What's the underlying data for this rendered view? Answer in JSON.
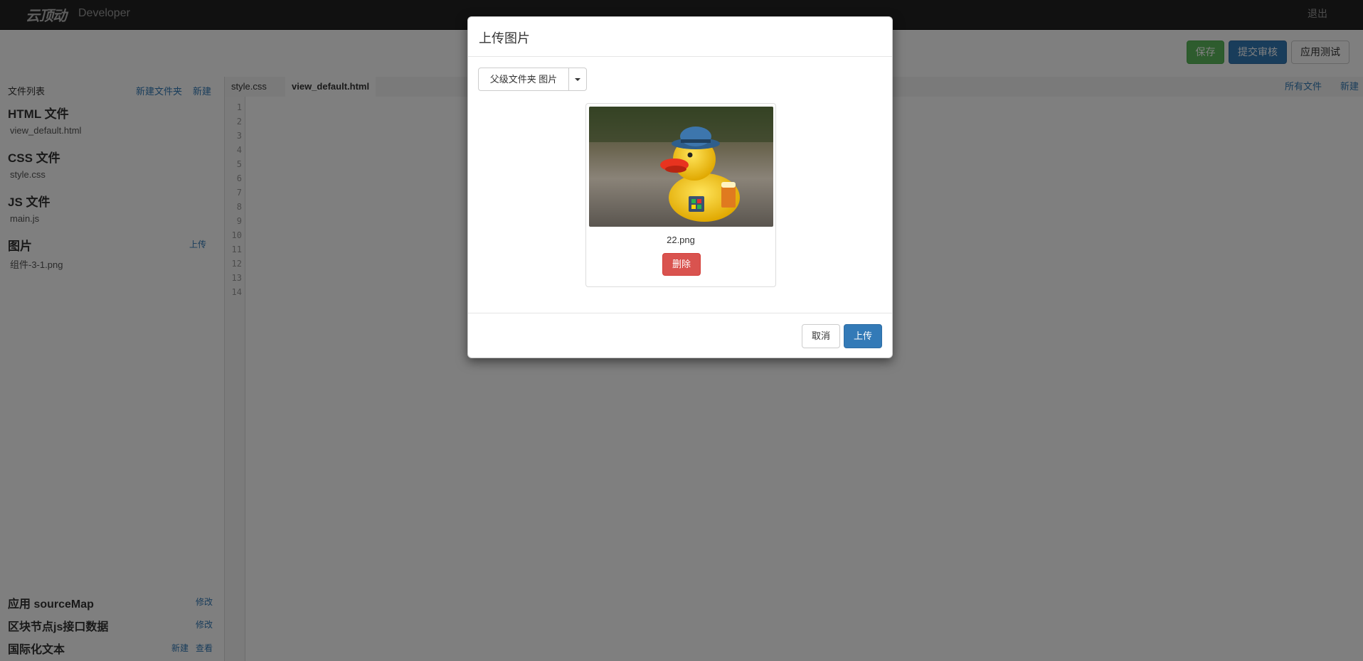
{
  "nav": {
    "logo": "云顶动",
    "brand": "Developer",
    "logout": "退出"
  },
  "toolbar": {
    "save": "保存",
    "submit": "提交审核",
    "test": "应用测试"
  },
  "sidebar": {
    "header": "文件列表",
    "new_folder": "新建文件夹",
    "new": "新建",
    "html_title": "HTML 文件",
    "html_file": "view_default.html",
    "css_title": "CSS 文件",
    "css_file": "style.css",
    "js_title": "JS 文件",
    "js_file": "main.js",
    "images_title": "图片",
    "images_upload": "上传",
    "image_file": "组件-3-1.png",
    "sourcemap_title": "应用 sourceMap",
    "sourcemap_action": "修改",
    "blocks_title": "区块节点js接口数据",
    "blocks_action": "修改",
    "i18n_title": "国际化文本",
    "i18n_new": "新建",
    "i18n_view": "查看"
  },
  "editor": {
    "tabs": [
      "style.css",
      "view_default.html"
    ],
    "all_files": "所有文件",
    "new": "新建",
    "line_numbers": [
      "1",
      "2",
      "3",
      "4",
      "5",
      "6",
      "7",
      "8",
      "9",
      "10",
      "11",
      "12",
      "13",
      "14"
    ]
  },
  "modal": {
    "title": "上传图片",
    "folder_label": "父级文件夹 图片",
    "image_name": "22.png",
    "delete": "删除",
    "cancel": "取消",
    "upload": "上传"
  },
  "colors": {
    "accent": "#337ab7",
    "success": "#5cb85c",
    "danger": "#d9534f",
    "topbar": "#222222"
  }
}
